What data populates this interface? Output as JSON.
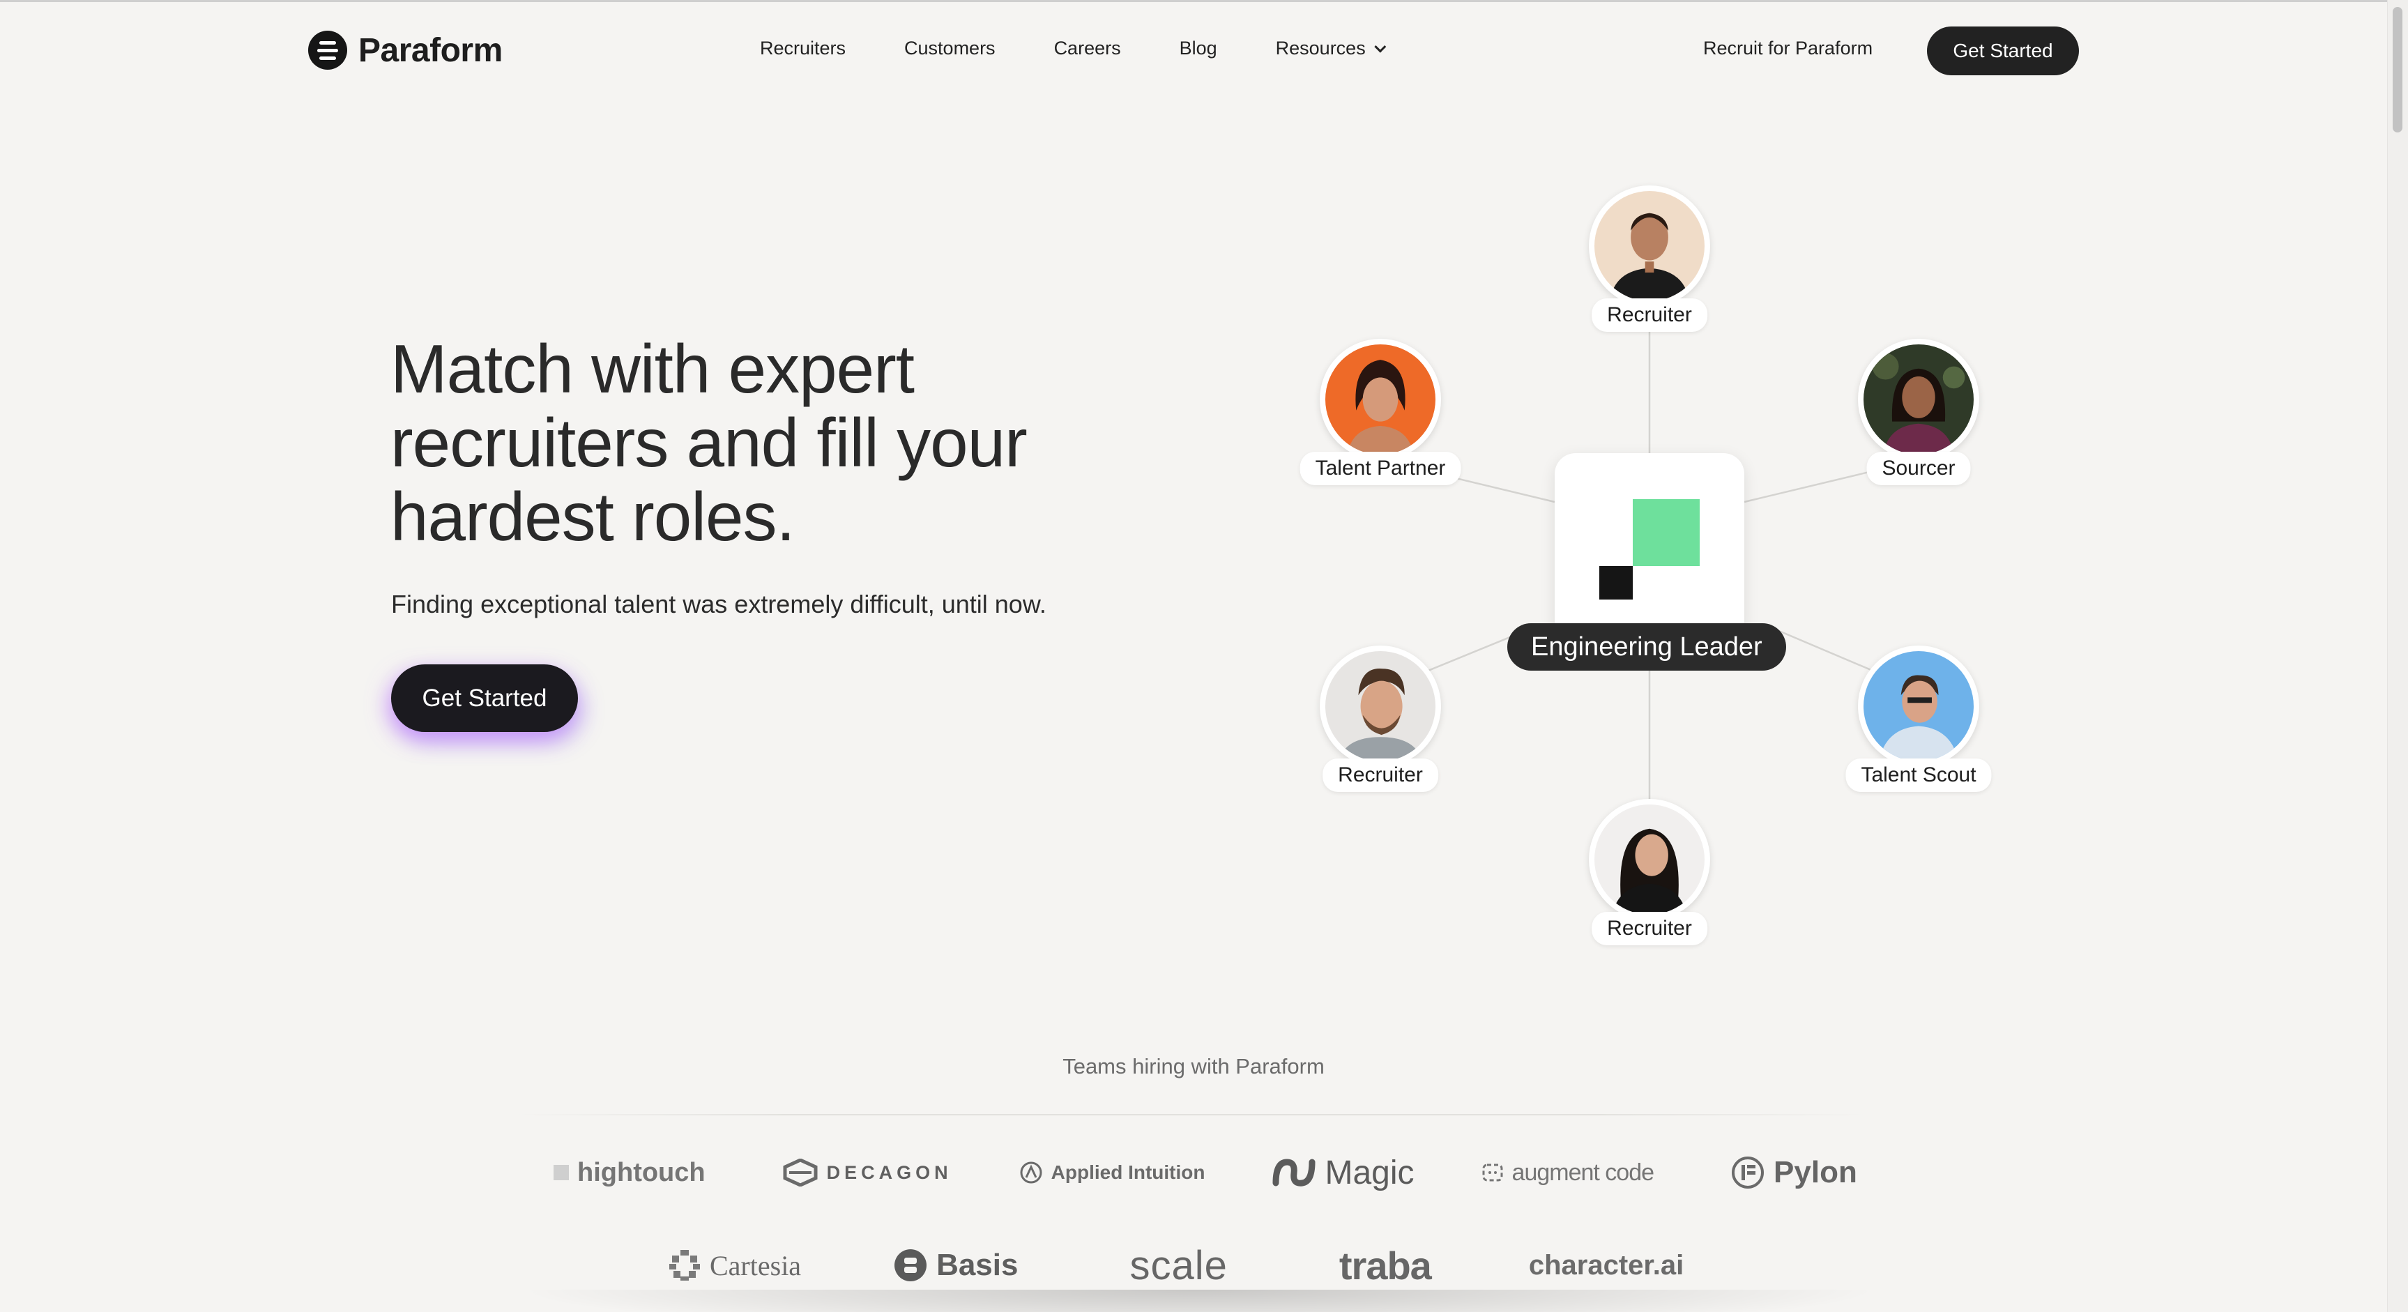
{
  "brand": {
    "name": "Paraform"
  },
  "nav": {
    "items": [
      {
        "label": "Recruiters"
      },
      {
        "label": "Customers"
      },
      {
        "label": "Careers"
      },
      {
        "label": "Blog"
      },
      {
        "label": "Resources",
        "has_dropdown": true
      }
    ],
    "recruit_link": "Recruit for Paraform",
    "cta": "Get Started"
  },
  "hero": {
    "title": "Match with expert recruiters and fill your hardest roles.",
    "subtitle": "Finding exceptional talent was extremely difficult, until now.",
    "cta": "Get Started"
  },
  "network": {
    "center_label": "Engineering Leader",
    "center_colors": {
      "green": "#6ee09c",
      "black": "#151515"
    },
    "nodes": [
      {
        "label": "Recruiter",
        "position": "top"
      },
      {
        "label": "Talent Partner",
        "position": "upper-left"
      },
      {
        "label": "Sourcer",
        "position": "upper-right"
      },
      {
        "label": "Recruiter",
        "position": "lower-left"
      },
      {
        "label": "Talent Scout",
        "position": "lower-right"
      },
      {
        "label": "Recruiter",
        "position": "bottom"
      }
    ]
  },
  "teams": {
    "heading": "Teams hiring with Paraform",
    "row1": [
      "hightouch",
      "DECAGON",
      "Applied Intuition",
      "Magic",
      "augment code",
      "Pylon"
    ],
    "row2": [
      "Cartesia",
      "Basis",
      "scale",
      "traba",
      "character.ai"
    ]
  },
  "colors": {
    "background": "#f5f4f2",
    "dark": "#222222",
    "accent_glow": "#be6eff"
  }
}
